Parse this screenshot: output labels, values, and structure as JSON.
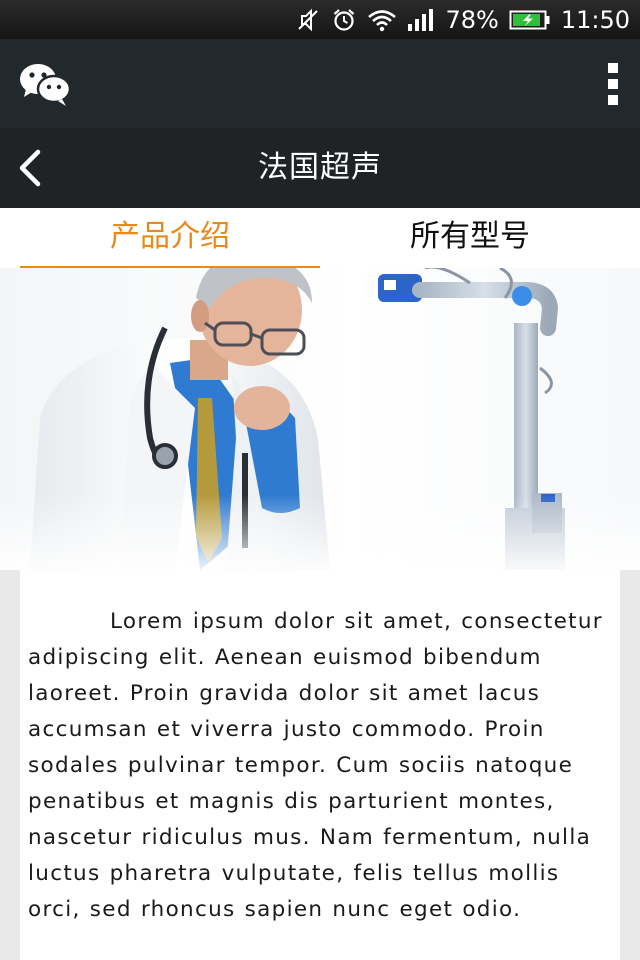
{
  "status_bar": {
    "battery_percent": "78%",
    "time": "11:50",
    "icons": [
      "mute-icon",
      "alarm-icon",
      "wifi-icon",
      "signal-icon",
      "battery-charging-icon"
    ]
  },
  "wechat_bar": {
    "logo_icon": "wechat-logo-icon",
    "menu_icon": "more-vertical-icon"
  },
  "title_bar": {
    "back_icon": "chevron-left-icon",
    "title": "法国超声"
  },
  "tabs": [
    {
      "label": "产品介绍",
      "active": true
    },
    {
      "label": "所有型号",
      "active": false
    }
  ],
  "colors": {
    "accent": "#e88a1a",
    "header_dark": "#22292c",
    "title_bar": "#1f2325"
  },
  "content": {
    "paragraph": "Lorem ipsum dolor sit amet, consectetur adipiscing elit. Aenean euismod bibendum laoreet. Proin gravida dolor sit amet lacus accumsan et viverra justo commodo. Proin sodales pulvinar tempor. Cum sociis natoque penatibus et magnis dis parturient montes, nascetur ridiculus mus. Nam fermentum, nulla luctus pharetra vulputate, felis tellus mollis orci, sed rhoncus sapien nunc eget odio."
  }
}
